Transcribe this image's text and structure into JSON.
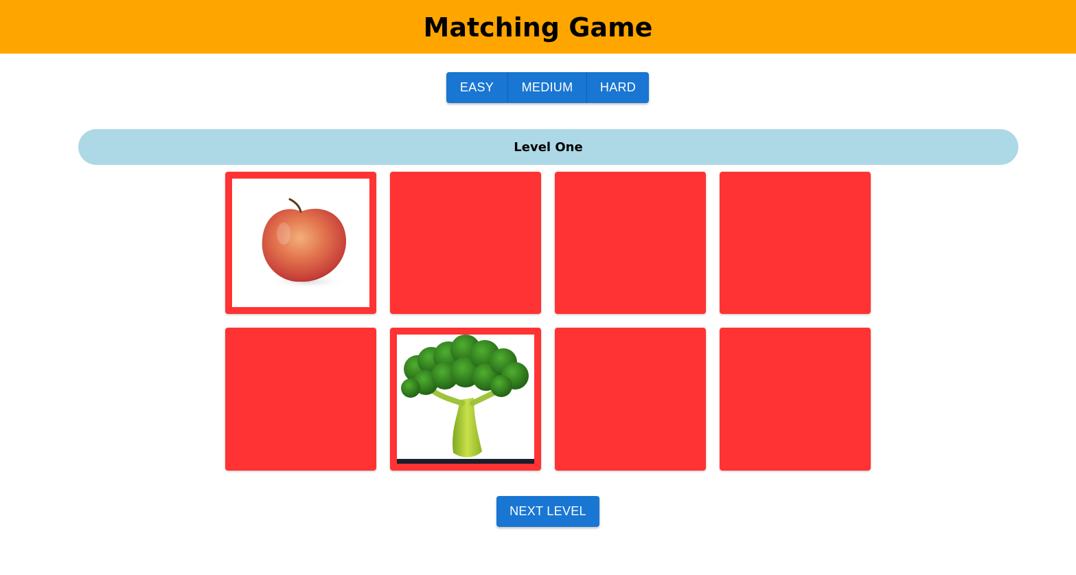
{
  "header": {
    "title": "Matching Game",
    "background": "#ffa500"
  },
  "difficulty": {
    "options": [
      {
        "label": "EASY"
      },
      {
        "label": "MEDIUM"
      },
      {
        "label": "HARD"
      }
    ],
    "color": "#1976d2"
  },
  "level": {
    "title": "Level One",
    "background": "#add8e6"
  },
  "board": {
    "card_back_color": "#ff3333",
    "cards": [
      {
        "state": "revealed",
        "image": "apple-icon"
      },
      {
        "state": "hidden"
      },
      {
        "state": "hidden"
      },
      {
        "state": "hidden"
      },
      {
        "state": "hidden"
      },
      {
        "state": "revealed",
        "image": "broccoli-icon"
      },
      {
        "state": "hidden"
      },
      {
        "state": "hidden"
      }
    ]
  },
  "actions": {
    "next_level_label": "NEXT LEVEL"
  }
}
